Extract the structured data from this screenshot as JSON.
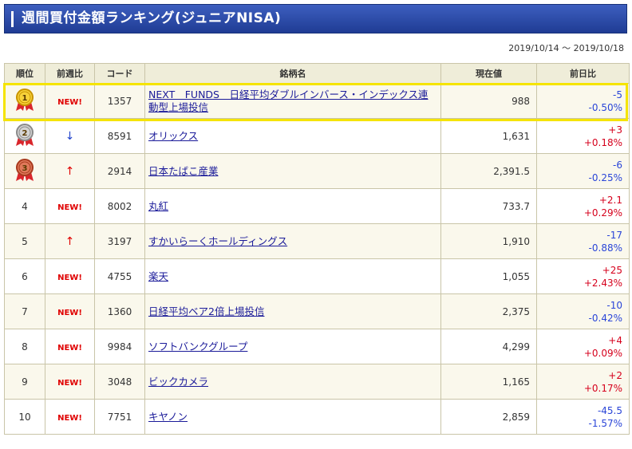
{
  "header": {
    "title": "週間買付金額ランキング(ジュニアNISA)"
  },
  "period": "2019/10/14 〜 2019/10/18",
  "table": {
    "columns": [
      "順位",
      "前週比",
      "コード",
      "銘柄名",
      "現在値",
      "前日比"
    ],
    "rows": [
      {
        "rank": "1",
        "change_vs_last_week": "NEW!",
        "code": "1357",
        "name": "NEXT　FUNDS　日経平均ダブルインバース・インデックス連動型上場投信",
        "price": "988",
        "diff": "-5",
        "diff_pct": "-0.50%",
        "sign": "minus",
        "medal": "gold"
      },
      {
        "rank": "2",
        "change_vs_last_week": "↓",
        "code": "8591",
        "name": "オリックス",
        "price": "1,631",
        "diff": "+3",
        "diff_pct": "+0.18%",
        "sign": "plus",
        "medal": "silver"
      },
      {
        "rank": "3",
        "change_vs_last_week": "↑",
        "code": "2914",
        "name": "日本たばこ産業",
        "price": "2,391.5",
        "diff": "-6",
        "diff_pct": "-0.25%",
        "sign": "minus",
        "medal": "bronze"
      },
      {
        "rank": "4",
        "change_vs_last_week": "NEW!",
        "code": "8002",
        "name": "丸紅",
        "price": "733.7",
        "diff": "+2.1",
        "diff_pct": "+0.29%",
        "sign": "plus"
      },
      {
        "rank": "5",
        "change_vs_last_week": "↑",
        "code": "3197",
        "name": "すかいらーくホールディングス",
        "price": "1,910",
        "diff": "-17",
        "diff_pct": "-0.88%",
        "sign": "minus"
      },
      {
        "rank": "6",
        "change_vs_last_week": "NEW!",
        "code": "4755",
        "name": "楽天",
        "price": "1,055",
        "diff": "+25",
        "diff_pct": "+2.43%",
        "sign": "plus"
      },
      {
        "rank": "7",
        "change_vs_last_week": "NEW!",
        "code": "1360",
        "name": "日経平均ベア2倍上場投信",
        "price": "2,375",
        "diff": "-10",
        "diff_pct": "-0.42%",
        "sign": "minus"
      },
      {
        "rank": "8",
        "change_vs_last_week": "NEW!",
        "code": "9984",
        "name": "ソフトバンクグループ",
        "price": "4,299",
        "diff": "+4",
        "diff_pct": "+0.09%",
        "sign": "plus"
      },
      {
        "rank": "9",
        "change_vs_last_week": "NEW!",
        "code": "3048",
        "name": "ビックカメラ",
        "price": "1,165",
        "diff": "+2",
        "diff_pct": "+0.17%",
        "sign": "plus"
      },
      {
        "rank": "10",
        "change_vs_last_week": "NEW!",
        "code": "7751",
        "name": "キヤノン",
        "price": "2,859",
        "diff": "-45.5",
        "diff_pct": "-1.57%",
        "sign": "minus"
      }
    ]
  },
  "colors": {
    "header_bg": "#2a4aa8",
    "plus": "#d6001c",
    "minus": "#2a45d8",
    "new": "#e00000",
    "highlight": "#f5e400"
  }
}
